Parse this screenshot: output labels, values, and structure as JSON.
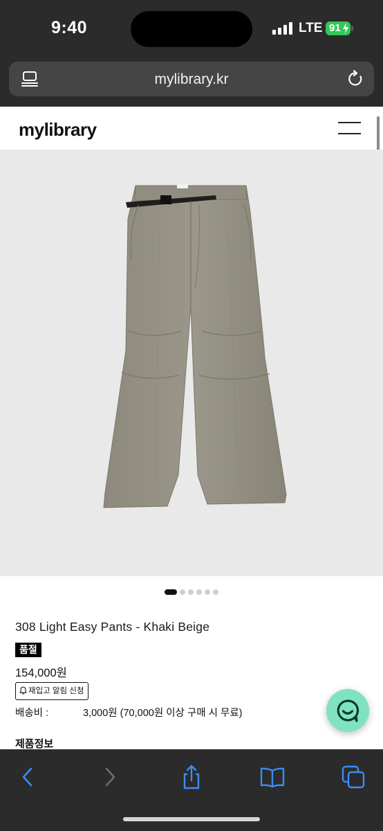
{
  "status_bar": {
    "time": "9:40",
    "network": "LTE",
    "battery": "91"
  },
  "browser": {
    "url": "mylibrary.kr"
  },
  "site": {
    "logo": "mylibrary"
  },
  "product": {
    "name": "308 Light Easy Pants - Khaki Beige",
    "badge": "품절",
    "price": "154,000원",
    "restock_label": "재입고 알림 신청",
    "shipping_label": "배송비 :",
    "shipping_value": "3,000원 (70,000원 이상 구매 시 무료)",
    "info_heading": "제품정보"
  },
  "carousel": {
    "total": 6,
    "active": 1
  },
  "colors": {
    "chrome": "#2b2b2b",
    "accent": "#7fe3bf",
    "battery": "#34c759",
    "toolbar_icon": "#3a8ef6"
  },
  "icons": [
    "reader-icon",
    "reload-icon",
    "menu-icon",
    "bell-icon",
    "chat-icon",
    "back-icon",
    "forward-icon",
    "share-icon",
    "bookmarks-icon",
    "tabs-icon"
  ]
}
